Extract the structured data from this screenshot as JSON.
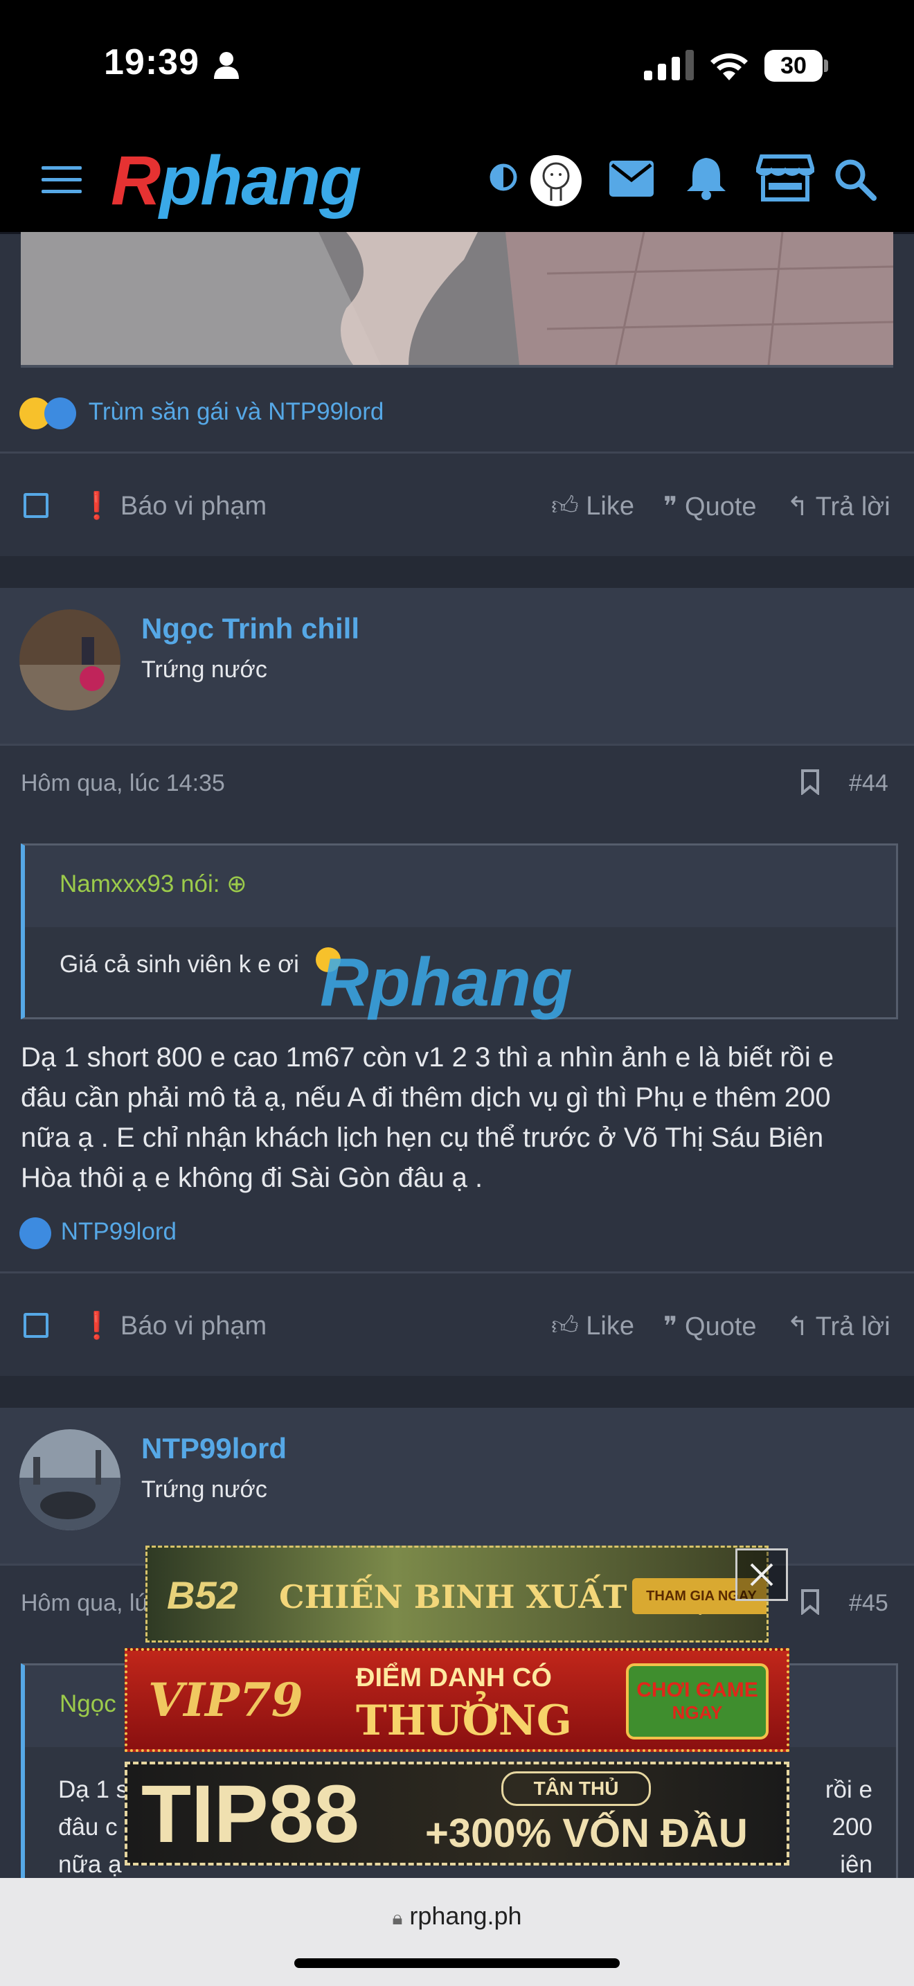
{
  "status_bar": {
    "time": "19:39",
    "battery": "30"
  },
  "header": {
    "logo": "Rphang",
    "logo_first": "R",
    "logo_rest": "phang"
  },
  "post43": {
    "reactions_text": "Trùm săn gái và NTP99lord",
    "actions": {
      "report": "Báo vi phạm",
      "like": "Like",
      "quote": "Quote",
      "reply": "Trả lời"
    }
  },
  "post44": {
    "username": "Ngọc Trinh chill",
    "user_title": "Trứng nước",
    "date": "Hôm qua, lúc 14:35",
    "number": "#44",
    "quote_author": "Namxxx93 nói:",
    "quote_text": "Giá cả sinh viên k e ơi",
    "watermark": "Rphang",
    "body_lines": [
      "Dạ 1 short 800 e cao 1m67 còn v1 2 3 thì a nhìn ảnh e là biết rồi e",
      "đâu cần phải mô tả ạ, nếu A đi thêm dịch vụ gì thì Phụ e thêm 200",
      "nữa ạ . E chỉ nhận khách lịch hẹn cụ thể trước ở Võ Thị Sáu Biên",
      "Hòa thôi ạ e không đi Sài Gòn đâu ạ ."
    ],
    "reactions_text": "NTP99lord",
    "actions": {
      "report": "Báo vi phạm",
      "like": "Like",
      "quote": "Quote",
      "reply": "Trả lời"
    }
  },
  "post45": {
    "username": "NTP99lord",
    "user_title": "Trứng nước",
    "date_partial": "Hôm qua, lú",
    "number": "#45",
    "quote_author_partial": "Ngọc",
    "quote_line1_left": "Dạ 1 s",
    "quote_line1_right": "rồi e",
    "quote_line2_left": "đâu c",
    "quote_line2_right": "200",
    "quote_line3_left": "nữa ạ",
    "quote_line3_right": "iên"
  },
  "ads": {
    "ad1": {
      "brand": "B52",
      "headline": "CHIẾN BINH XUẤT TRẬN",
      "cta": "THAM GIA NGAY"
    },
    "ad2": {
      "brand": "VIP79",
      "line1": "ĐIỂM DANH CÓ",
      "line2": "THƯỞNG",
      "cta1": "CHƠI GAME",
      "cta2": "NGAY"
    },
    "ad3": {
      "brand": "TIP88",
      "badge": "TÂN THỦ",
      "offer": "+300% VỐN ĐẦU"
    }
  },
  "browser": {
    "url": "rphang.ph"
  }
}
